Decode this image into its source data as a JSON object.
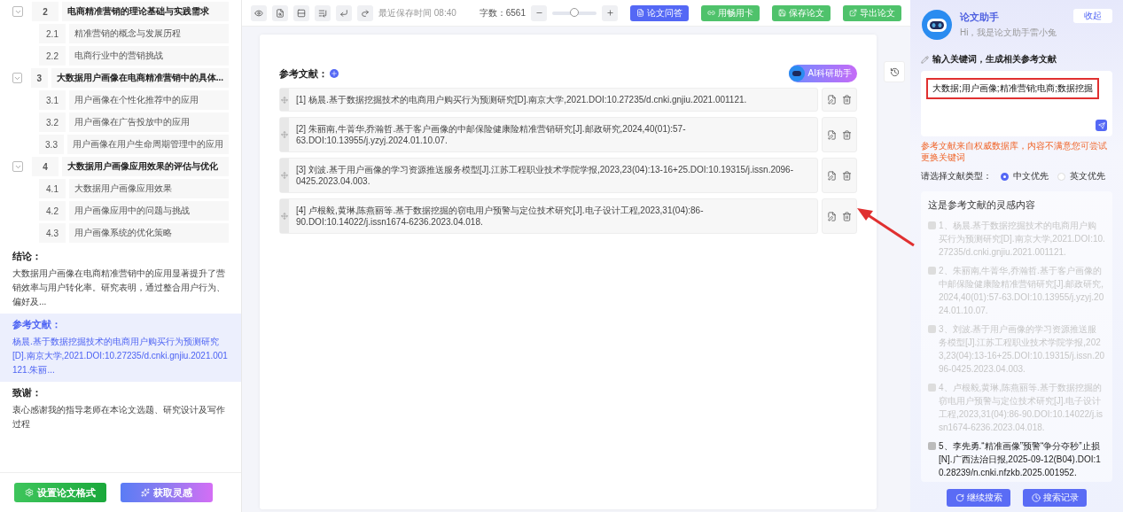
{
  "outline": [
    {
      "number": "2",
      "title": "电商精准营销的理论基础与实践需求",
      "expanded": true,
      "children": [
        {
          "number": "2.1",
          "title": "精准营销的概念与发展历程"
        },
        {
          "number": "2.2",
          "title": "电商行业中的营销挑战"
        }
      ]
    },
    {
      "number": "3",
      "title": "大数据用户画像在电商精准营销中的具体...",
      "expanded": true,
      "children": [
        {
          "number": "3.1",
          "title": "用户画像在个性化推荐中的应用"
        },
        {
          "number": "3.2",
          "title": "用户画像在广告投放中的应用"
        },
        {
          "number": "3.3",
          "title": "用户画像在用户生命周期管理中的应用"
        }
      ]
    },
    {
      "number": "4",
      "title": "大数据用户画像应用效果的评估与优化",
      "expanded": true,
      "children": [
        {
          "number": "4.1",
          "title": "大数据用户画像应用效果"
        },
        {
          "number": "4.2",
          "title": "用户画像应用中的问题与挑战"
        },
        {
          "number": "4.3",
          "title": "用户画像系统的优化策略"
        }
      ]
    }
  ],
  "sections": [
    {
      "heading": "结论：",
      "text": "大数据用户画像在电商精准营销中的应用显著提升了营销效率与用户转化率。研究表明，通过整合用户行为、偏好及...",
      "selected": false
    },
    {
      "heading": "参考文献：",
      "text": "杨晨.基于数据挖掘技术的电商用户购买行为预测研究[D].南京大学,2021.DOI:10.27235/d.cnki.gnjiu.2021.001121.朱丽...",
      "selected": true
    },
    {
      "heading": "致谢：",
      "text": "衷心感谢我的指导老师在本论文选题、研究设计及写作过程",
      "selected": false
    }
  ],
  "sidebar_buttons": [
    {
      "label": "设置论文格式",
      "kind": "format"
    },
    {
      "label": "获取灵感",
      "kind": "inspire"
    }
  ],
  "toolbar": {
    "last_saved": "最近保存时间 08:40",
    "word_count": "字数：6561",
    "zoom": {
      "level": 0.5
    },
    "buttons": [
      {
        "label": "论文问答",
        "kind": "primary"
      },
      {
        "label": "用畅用卡",
        "kind": "card"
      },
      {
        "label": "保存论文",
        "kind": "save"
      },
      {
        "label": "导出论文",
        "kind": "export"
      }
    ]
  },
  "document": {
    "heading": "参考文献：",
    "assistant_badge": "AI科研助手",
    "references": [
      "[1] 杨晨.基于数据挖掘技术的电商用户购买行为预测研究[D].南京大学,2021.DOI:10.27235/d.cnki.gnjiu.2021.001121.",
      "[2] 朱丽南,牛菁华,乔瀚哲.基于客户画像的中邮保险健康险精准营销研究[J].邮政研究,2024,40(01):57-63.DOI:10.13955/j.yzyj.2024.01.10.07.",
      "[3] 刘波.基于用户画像的学习资源推送服务模型[J].江苏工程职业技术学院学报,2023,23(04):13-16+25.DOI:10.19315/j.issn.2096-0425.2023.04.003.",
      "[4] 卢根毅,黄琳,陈燕丽等.基于数据挖掘的窃电用户预警与定位技术研究[J].电子设计工程,2023,31(04):86-90.DOI:10.14022/j.issn1674-6236.2023.04.018."
    ]
  },
  "assistant": {
    "title": "论文助手",
    "greeting": "Hi，我是论文助手雷小兔",
    "collapse": "收起",
    "prompt": "输入关键词，生成相关参考文献",
    "keywords": "大数据;用户画像;精准营销;电商;数据挖掘",
    "notice": "参考文献来自权威数据库，内容不满意您可尝试更换关键词",
    "type_label": "请选择文献类型：",
    "types": [
      {
        "label": "中文优先",
        "selected": true
      },
      {
        "label": "英文优先",
        "selected": false
      }
    ],
    "results_title": "这是参考文献的灵感内容",
    "results": [
      {
        "text": "1、杨晨.基于数据挖掘技术的电商用户购买行为预测研究[D].南京大学,2021.DOI:10.27235/d.cnki.gnjiu.2021.001121.",
        "added": true
      },
      {
        "text": "2、朱丽南,牛菁华,乔瀚哲.基于客户画像的中邮保险健康险精准营销研究[J].邮政研究,2024,40(01):57-63.DOI:10.13955/j.yzyj.2024.01.10.07.",
        "added": true
      },
      {
        "text": "3、刘波.基于用户画像的学习资源推送服务模型[J].江苏工程职业技术学院学报,2023,23(04):13-16+25.DOI:10.19315/j.issn.2096-0425.2023.04.003.",
        "added": true
      },
      {
        "text": "4、卢根毅,黄琳,陈燕丽等.基于数据挖掘的窃电用户预警与定位技术研究[J].电子设计工程,2023,31(04):86-90.DOI:10.14022/j.issn1674-6236.2023.04.018.",
        "added": true
      },
      {
        "text": "5、李先勇.“精准画像”预警“争分夺秒”止损[N].广西法治日报,2025-09-12(B04).DOI:10.28239/n.cnki.nfzkb.2025.001952.",
        "added": false
      }
    ],
    "actions": [
      {
        "label": "继续搜索",
        "kind": "continue"
      },
      {
        "label": "搜索记录",
        "kind": "history"
      }
    ]
  }
}
